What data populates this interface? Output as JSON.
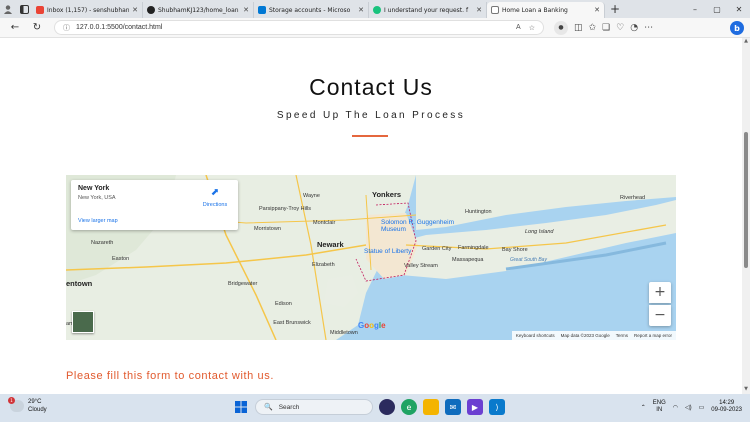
{
  "browser": {
    "tabs": [
      {
        "title": "Inbox (1,157) - senshubhan",
        "color": "#ea4335",
        "active": false
      },
      {
        "title": "ShubhamKJ123/home_loan",
        "color": "#222222",
        "active": false
      },
      {
        "title": "Storage accounts - Microso",
        "color": "#0078d4",
        "active": false
      },
      {
        "title": "I understand your request. f",
        "color": "#19c37d",
        "active": false
      },
      {
        "title": "Home Loan a Banking",
        "color": "#666666",
        "active": true
      }
    ],
    "url": "127.0.0.1:5500/contact.html",
    "new_tab_glyph": "+",
    "window_controls": [
      "–",
      "▢",
      "✕"
    ]
  },
  "page": {
    "heading": "Contact Us",
    "subheading": "Speed Up The Loan Process",
    "form_title": "Please fill this form to contact with us."
  },
  "map": {
    "place_name": "New York",
    "place_address": "New York, USA",
    "directions_label": "Directions",
    "view_larger": "View larger map",
    "zoom_in": "+",
    "zoom_out": "−",
    "google_logo": "Google",
    "attribution": {
      "shortcuts": "Keyboard shortcuts",
      "data": "Map data ©2023 Google",
      "terms": "Terms",
      "report": "Report a map error"
    },
    "labels": {
      "yonkers": "Yonkers",
      "newark": "Newark",
      "wayne": "Wayne",
      "parsippany": "Parsippany-Troy Hills",
      "montclair": "Montclair",
      "morristown": "Morristown",
      "nazareth": "Nazareth",
      "easton": "Easton",
      "allentown": "entown",
      "elizabeth": "Elizabeth",
      "bridgewater": "Bridgewater",
      "edison": "Edison",
      "eastbrunswick": "East Brunswick",
      "middletown": "Middletown",
      "statueofliberty": "Statue of Liberty",
      "guggenheim": "Solomon R. Guggenheim Museum",
      "huntington": "Huntington",
      "riverhead": "Riverhead",
      "longisland": "Long Island",
      "gardencity": "Garden City",
      "farmingdale": "Farmingdale",
      "bayshore": "Bay Shore",
      "valleystream": "Valley Stream",
      "massapequa": "Massapequa",
      "greatsouthbay": "Great South Bay",
      "amtown": "amtown"
    }
  },
  "taskbar": {
    "temperature": "29°C",
    "condition": "Cloudy",
    "weather_badge": "1",
    "search_placeholder": "Search",
    "lang_line1": "ENG",
    "lang_line2": "IN",
    "time": "14:29",
    "date": "09-09-2023"
  }
}
